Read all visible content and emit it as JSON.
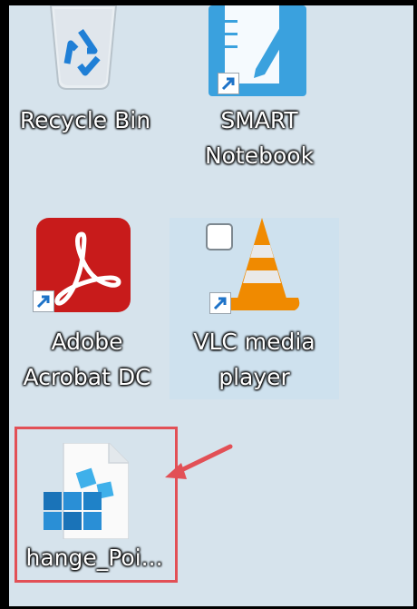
{
  "desktop": {
    "icons": [
      {
        "label": "Recycle Bin",
        "icon": "recycle-bin-icon"
      },
      {
        "label": "SMART Notebook",
        "line1": "SMART",
        "line2": "Notebook",
        "icon": "smart-notebook-icon"
      },
      {
        "label": "Adobe Acrobat DC",
        "line1": "Adobe",
        "line2": "Acrobat DC",
        "icon": "adobe-acrobat-icon"
      },
      {
        "label": "VLC media player",
        "line1": "VLC media",
        "line2": "player",
        "icon": "vlc-cone-icon"
      },
      {
        "label": "hange_Poi...",
        "icon": "registry-file-icon"
      }
    ]
  },
  "annotation": {
    "highlight_color": "#e25056",
    "arrow_color": "#e25056"
  }
}
